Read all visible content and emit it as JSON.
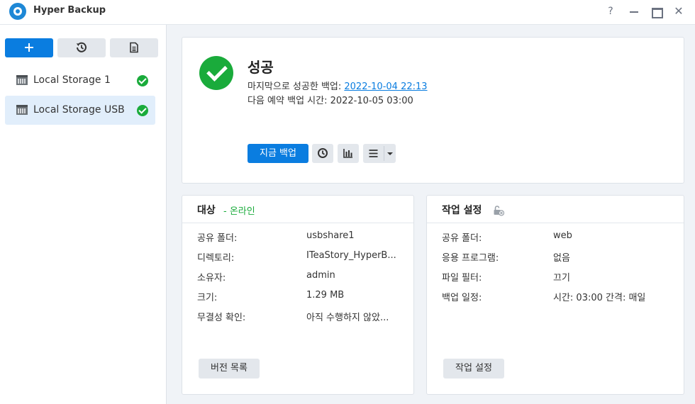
{
  "window": {
    "title": "Hyper Backup",
    "help": "?",
    "close": "✕"
  },
  "sidebar": {
    "items": [
      {
        "label": "Local Storage 1",
        "status": "success",
        "active": false
      },
      {
        "label": "Local Storage USB",
        "status": "success",
        "active": true
      }
    ]
  },
  "status": {
    "title": "성공",
    "last_backup_label": "마지막으로 성공한 백업: ",
    "last_backup_value": "2022-10-04 22:13",
    "next_backup_label": "다음 예약 백업 시간: ",
    "next_backup_value": "2022-10-05 03:00",
    "backup_now_label": "지금 백업"
  },
  "target": {
    "title": "대상",
    "online": "- 온라인",
    "rows": [
      {
        "label": "공유 폴더:",
        "value": "usbshare1"
      },
      {
        "label": "디렉토리:",
        "value": "ITeaStory_HyperB..."
      },
      {
        "label": "소유자:",
        "value": "admin"
      },
      {
        "label": "크기:",
        "value": "1.29 MB"
      },
      {
        "label": "무결성 확인:",
        "value": "아직 수행하지 않았..."
      }
    ],
    "button": "버전 목록"
  },
  "task_settings": {
    "title": "작업 설정",
    "rows": [
      {
        "label": "공유 폴더:",
        "value": "web"
      },
      {
        "label": "응용 프로그램:",
        "value": "없음"
      },
      {
        "label": "파일 필터:",
        "value": "끄기"
      },
      {
        "label": "백업 일정:",
        "value": "시간: 03:00 간격: 매일"
      }
    ],
    "button": "작업 설정"
  },
  "colors": {
    "accent": "#0a7de0",
    "success": "#1aab3b",
    "sidebar_active": "#e1eefb"
  }
}
